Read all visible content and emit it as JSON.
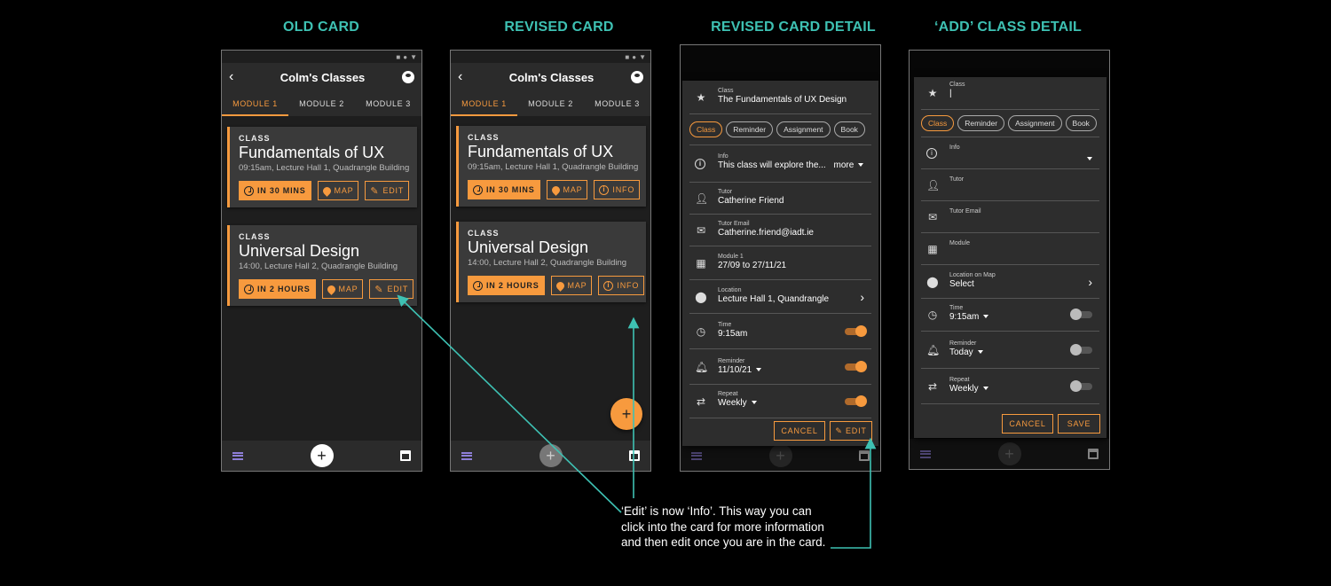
{
  "headings": {
    "old": "OLD CARD",
    "revised": "REVISED CARD",
    "revised_detail": "REVISED CARD DETAIL",
    "add_detail": "‘ADD’ CLASS DETAIL"
  },
  "app": {
    "title": "Colm's Classes",
    "tabs": [
      "MODULE 1",
      "MODULE 2",
      "MODULE 3"
    ]
  },
  "old_cards": [
    {
      "label": "CLASS",
      "name": "Fundamentals of UX",
      "sub": "09:15am, Lecture Hall 1, Quadrangle Building",
      "time": "IN 30 MINS",
      "map": "MAP",
      "action": "EDIT"
    },
    {
      "label": "CLASS",
      "name": "Universal Design",
      "sub": "14:00, Lecture Hall 2, Quadrangle Building",
      "time": "IN 2 HOURS",
      "map": "MAP",
      "action": "EDIT"
    }
  ],
  "revised_cards": [
    {
      "label": "CLASS",
      "name": "Fundamentals of UX",
      "sub": "09:15am, Lecture Hall 1, Quadrangle Building",
      "time": "IN 30 MINS",
      "map": "MAP",
      "action": "INFO"
    },
    {
      "label": "CLASS",
      "name": "Universal Design",
      "sub": "14:00, Lecture Hall 2, Quadrangle Building",
      "time": "IN 2 HOURS",
      "map": "MAP",
      "action": "INFO"
    }
  ],
  "chips": [
    "Class",
    "Reminder",
    "Assignment",
    "Book"
  ],
  "detail": {
    "class_label": "Class",
    "class_value": "The Fundamentals of UX Design",
    "info_label": "Info",
    "info_value": "This class will explore the...",
    "more": "more",
    "tutor_label": "Tutor",
    "tutor_value": "Catherine Friend",
    "email_label": "Tutor Email",
    "email_value": "Catherine.friend@iadt.ie",
    "module_label": "Module 1",
    "module_value": "27/09 to 27/11/21",
    "location_label": "Location",
    "location_value": "Lecture Hall 1, Quandrangle",
    "time_label": "Time",
    "time_value": "9:15am",
    "reminder_label": "Reminder",
    "reminder_value": "11/10/21",
    "repeat_label": "Repeat",
    "repeat_value": "Weekly",
    "cancel": "CANCEL",
    "edit": "EDIT"
  },
  "add": {
    "class_label": "Class",
    "class_value": "|",
    "info_label": "Info",
    "tutor_label": "Tutor",
    "email_label": "Tutor Email",
    "module_label": "Module",
    "location_label": "Location on Map",
    "location_value": "Select",
    "time_label": "Time",
    "time_value": "9:15am",
    "reminder_label": "Reminder",
    "reminder_value": "Today",
    "repeat_label": "Repeat",
    "repeat_value": "Weekly",
    "cancel": "CANCEL",
    "save": "SAVE"
  },
  "annotation": "‘Edit’ is now ‘Info’. This way you can click into the card for more information and then edit once you are in the card.",
  "colors": {
    "accent": "#f79a3e",
    "annotation": "#3ec1b3",
    "background": "#000000"
  }
}
